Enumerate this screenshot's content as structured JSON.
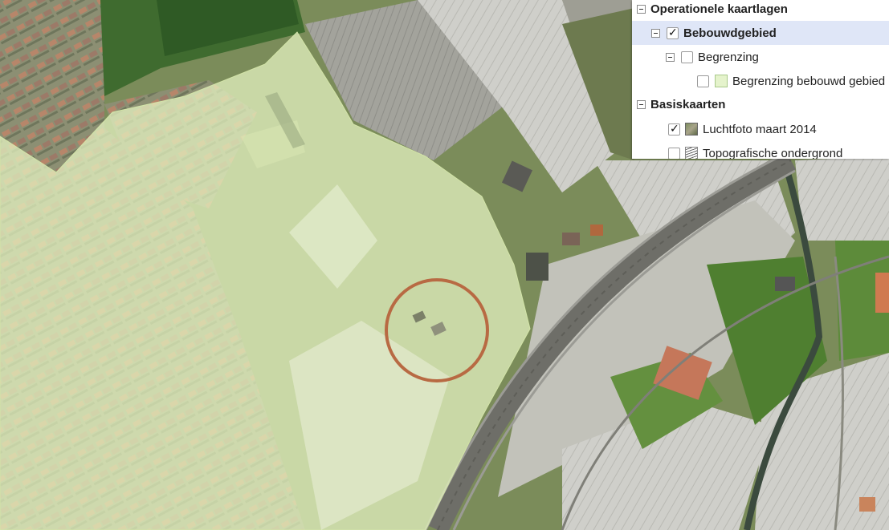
{
  "layer_tree": {
    "operational": {
      "label": "Operationele kaartlagen"
    },
    "bebouwdgebied": {
      "label": "Bebouwdgebied",
      "checked": true
    },
    "begrenzing": {
      "label": "Begrenzing",
      "checked": false
    },
    "begrenzing_bebouwd": {
      "label": "Begrenzing bebouwd gebied",
      "checked": false,
      "swatch_color": "#e5f3cc"
    },
    "basiskaarten": {
      "label": "Basiskaarten"
    },
    "luchtfoto": {
      "label": "Luchtfoto maart 2014",
      "checked": true
    },
    "topografisch": {
      "label": "Topografische ondergrond",
      "checked": false
    }
  },
  "map": {
    "overlay_color": "#e8f5c4",
    "marker_color": "#b86a43"
  }
}
